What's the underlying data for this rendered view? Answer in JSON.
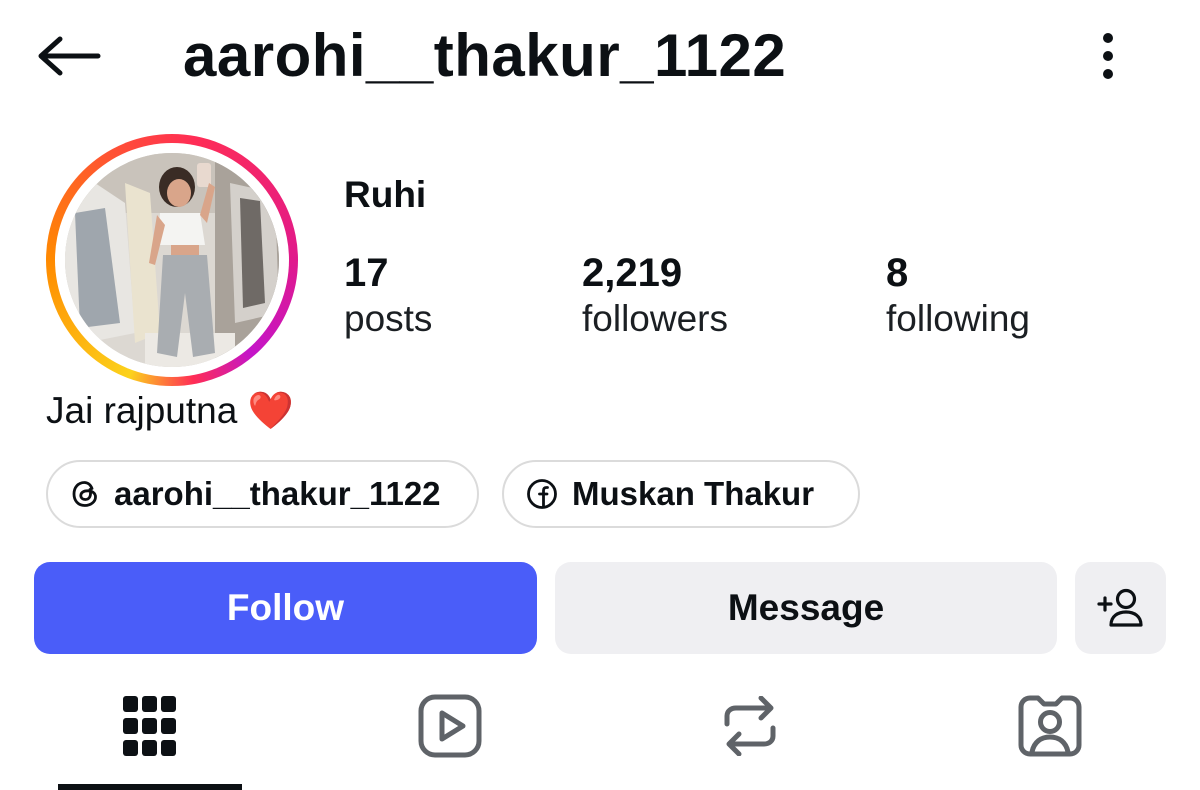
{
  "header": {
    "username": "aarohi__thakur_1122",
    "back_icon": "arrow-left-icon",
    "more_icon": "vertical-dots-icon"
  },
  "profile": {
    "display_name": "Ruhi",
    "avatar_icon": "profile-photo",
    "stats": [
      {
        "count": "17",
        "label": "posts"
      },
      {
        "count": "2,219",
        "label": "followers"
      },
      {
        "count": "8",
        "label": "following"
      }
    ],
    "bio": "Jai rajputna ❤️"
  },
  "links": [
    {
      "icon": "threads-icon",
      "text": "aarohi__thakur_1122"
    },
    {
      "icon": "facebook-icon",
      "text": "Muskan Thakur"
    }
  ],
  "actions": {
    "follow_label": "Follow",
    "message_label": "Message",
    "add_user_icon": "add-user-icon"
  },
  "tabs": [
    {
      "icon": "grid-icon",
      "active": true
    },
    {
      "icon": "reels-icon",
      "active": false
    },
    {
      "icon": "repost-icon",
      "active": false
    },
    {
      "icon": "tagged-icon",
      "active": false
    }
  ],
  "colors": {
    "follow_button": "#4a5df9",
    "secondary_button": "#efeff2",
    "text": "#0c1014",
    "story_ring_start": "#c415c9",
    "story_ring_end": "#fcd21c"
  }
}
